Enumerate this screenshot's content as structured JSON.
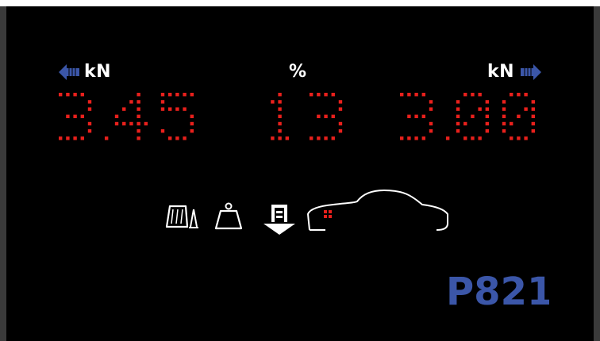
{
  "display": {
    "left": {
      "unit": "kN",
      "value": "3.45",
      "icon": "arrow-left-icon"
    },
    "center": {
      "unit": "%",
      "value": "13"
    },
    "right": {
      "unit": "kN",
      "value": "3.00",
      "icon": "arrow-right-icon"
    }
  },
  "status_icons": [
    {
      "name": "wiper-icon"
    },
    {
      "name": "weight-icon"
    },
    {
      "name": "down-arrow-icon"
    },
    {
      "name": "car-icon"
    }
  ],
  "brand": {
    "label": "P821"
  },
  "colors": {
    "background": "#000000",
    "led": "#e8201c",
    "text": "#ffffff",
    "accent": "#3b56a8"
  }
}
